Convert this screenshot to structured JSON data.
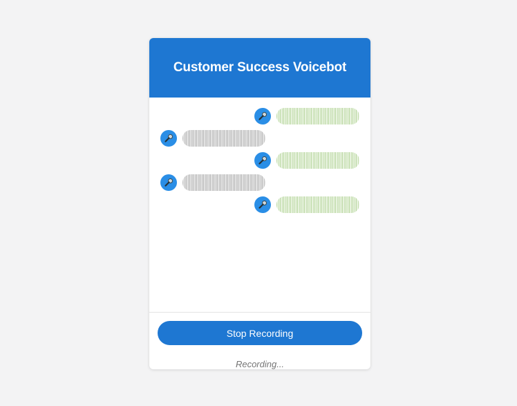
{
  "header": {
    "title": "Customer Success Voicebot"
  },
  "messages": [
    {
      "role": "user",
      "type": "voice",
      "icon": "microphone-icon"
    },
    {
      "role": "bot",
      "type": "voice",
      "icon": "microphone-icon"
    },
    {
      "role": "user",
      "type": "voice",
      "icon": "microphone-icon"
    },
    {
      "role": "bot",
      "type": "voice",
      "icon": "microphone-icon"
    },
    {
      "role": "user",
      "type": "voice",
      "icon": "microphone-icon"
    }
  ],
  "controls": {
    "stop_label": "Stop Recording"
  },
  "status": {
    "text": "Recording..."
  },
  "colors": {
    "accent": "#1e77d2",
    "mic_badge": "#2a8ee6",
    "user_wave": "#c6deb2",
    "bot_wave": "#c7c7c7",
    "background": "#f3f3f4"
  }
}
